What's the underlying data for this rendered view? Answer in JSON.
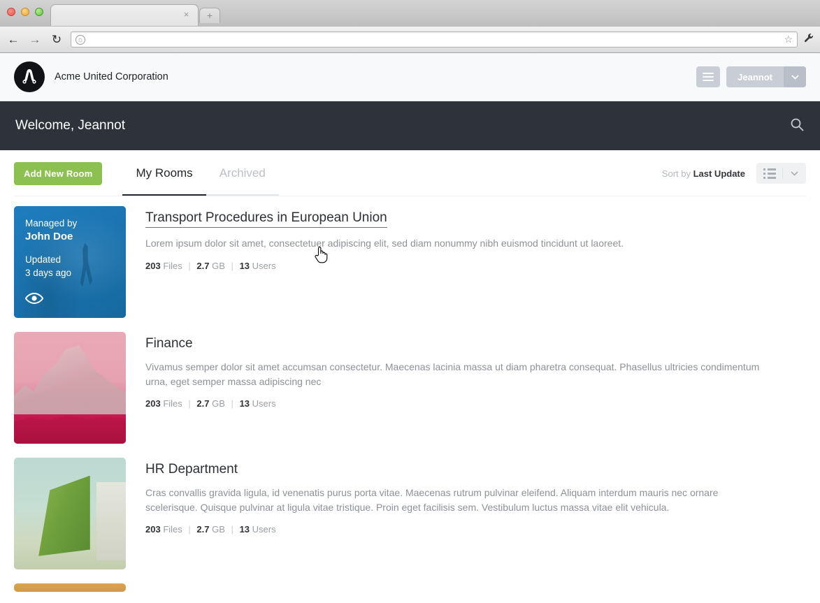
{
  "browser": {
    "tab_title": "",
    "tab_close_label": "×",
    "newtab_label": "+",
    "back_label": "←",
    "forward_label": "→",
    "reload_label": "↻",
    "address_value": "",
    "address_placeholder": "",
    "globe_icon": "globe-icon",
    "star_icon": "☆",
    "wrench_icon": "🔧"
  },
  "header": {
    "brand_name": "Acme United Corporation",
    "menu_icon": "hamburger-icon",
    "user_name": "Jeannot",
    "user_caret": "⌄"
  },
  "welcome": {
    "text": "Welcome, Jeannot",
    "search_icon": "search-icon"
  },
  "toolbar": {
    "add_room_label": "Add New Room",
    "tabs": [
      {
        "label": "My Rooms",
        "state": "active"
      },
      {
        "label": "Archived",
        "state": "inactive"
      }
    ],
    "sort_prefix": "Sort by ",
    "sort_value": "Last Update",
    "view_icon": "list-view-icon",
    "view_caret": "⌄"
  },
  "colors": {
    "accent_green": "#8cc152",
    "banner_dark": "#2e323b",
    "hover_blue": "#1a76b8",
    "muted_text": "#8d9199"
  },
  "rooms": [
    {
      "title": "Transport Procedures in European Union",
      "description": "Lorem ipsum dolor sit amet, consectetuer adipiscing elit, sed diam nonummy nibh euismod tincidunt ut laoreet.",
      "files_count": "203",
      "files_label": "Files",
      "size_value": "2.7",
      "size_label": "GB",
      "users_count": "13",
      "users_label": "Users",
      "thumb_style": "blue",
      "hovered": true,
      "overlay": {
        "managed_by_label": "Managed by",
        "manager": "John Doe",
        "updated_label": "Updated",
        "updated_value": "3 days ago",
        "eye_icon": "eye-icon"
      }
    },
    {
      "title": "Finance",
      "description": "Vivamus semper dolor sit amet accumsan consectetur. Maecenas lacinia massa ut diam pharetra consequat. Phasellus ultricies condimentum urna, eget semper massa adipiscing nec",
      "files_count": "203",
      "files_label": "Files",
      "size_value": "2.7",
      "size_label": "GB",
      "users_count": "13",
      "users_label": "Users",
      "thumb_style": "pink",
      "hovered": false
    },
    {
      "title": "HR Department",
      "description": "Cras convallis gravida ligula, id venenatis purus porta vitae. Maecenas rutrum pulvinar eleifend. Aliquam interdum mauris nec ornare scelerisque. Quisque pulvinar at ligula vitae tristique. Proin eget facilisis sem. Vestibulum luctus massa vitae elit vehicula.",
      "files_count": "203",
      "files_label": "Files",
      "size_value": "2.7",
      "size_label": "GB",
      "users_count": "13",
      "users_label": "Users",
      "thumb_style": "green",
      "hovered": false
    }
  ],
  "separators": {
    "pipe": "|"
  }
}
